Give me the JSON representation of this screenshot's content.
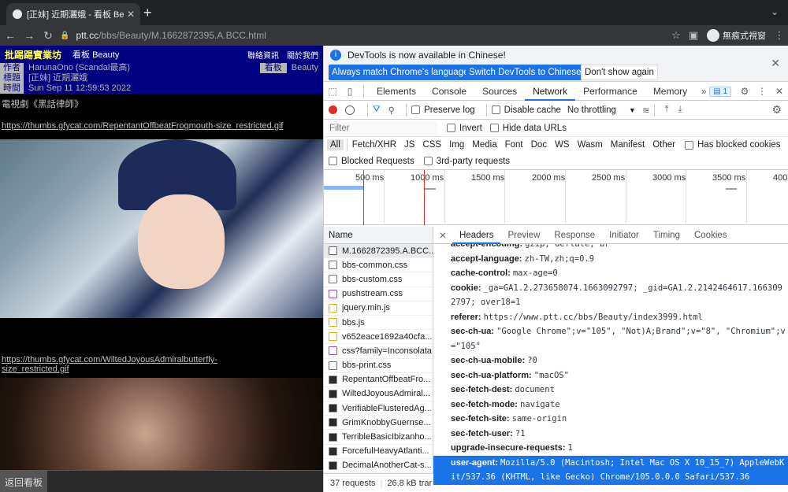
{
  "browser": {
    "tab_title": "[正妹] 近期灑娥 - 看板 Beauty - ",
    "url_host": "ptt.cc",
    "url_path": "/bbs/Beauty/M.1662872395.A.BCC.html",
    "profile_label": "無痕式視窗",
    "icons": {
      "back": "arrow-left-icon",
      "forward": "arrow-right-icon",
      "reload": "reload-icon",
      "lock": "lock-icon",
      "star": "star-icon",
      "new_tab": "plus-icon"
    }
  },
  "ptt": {
    "site_name": "批踢踢實業坊",
    "board_label": "看板 Beauty",
    "link_about": "聯絡資訊",
    "link_about2": "關於我們",
    "author_key": "作者",
    "author_val": "HarunaOno (Scandal最高)",
    "board_key": "看板",
    "board_val": "Beauty",
    "title_key": "標題",
    "title_val": "[正妹] 近期灑娥",
    "time_key": "時間",
    "time_val": "Sun Sep 11 12:59:53 2022",
    "body_title": "電視劇《黑話律師》",
    "link1": "https://thumbs.gfycat.com/RepentantOffbeatFrogmouth-size_restricted.gif",
    "link2a": "https://thumbs.gfycat.com/WiltedJoyousAdmiralbutterfly-",
    "link2b": "size_restricted.gif",
    "back_board": "返回看板"
  },
  "devtools": {
    "info_message": "DevTools is now available in Chinese!",
    "btn_match": "Always match Chrome's language",
    "btn_switch": "Switch DevTools to Chinese",
    "btn_dont": "Don't show again",
    "tabs": [
      "Elements",
      "Console",
      "Sources",
      "Network",
      "Performance",
      "Memory"
    ],
    "active_tab": "Network",
    "issues_count": "1",
    "preserve_log": "Preserve log",
    "disable_cache": "Disable cache",
    "throttling": "No throttling",
    "filter_placeholder": "Filter",
    "invert": "Invert",
    "hide_data_urls": "Hide data URLs",
    "types": [
      "All",
      "Fetch/XHR",
      "JS",
      "CSS",
      "Img",
      "Media",
      "Font",
      "Doc",
      "WS",
      "Wasm",
      "Manifest",
      "Other"
    ],
    "has_blocked_cookies": "Has blocked cookies",
    "blocked_requests": "Blocked Requests",
    "third_party": "3rd-party requests",
    "timeline_ticks": [
      "500 ms",
      "1000 ms",
      "1500 ms",
      "2000 ms",
      "2500 ms",
      "3000 ms",
      "3500 ms",
      "400"
    ],
    "name_header": "Name",
    "requests": [
      {
        "name": "M.1662872395.A.BCC...",
        "kind": "doc"
      },
      {
        "name": "bbs-common.css",
        "kind": "css"
      },
      {
        "name": "bbs-custom.css",
        "kind": "css"
      },
      {
        "name": "pushstream.css",
        "kind": "css"
      },
      {
        "name": "jquery.min.js",
        "kind": "js"
      },
      {
        "name": "bbs.js",
        "kind": "js"
      },
      {
        "name": "v652eace1692a40cfa...",
        "kind": "js"
      },
      {
        "name": "css?family=Inconsolata",
        "kind": "css"
      },
      {
        "name": "bbs-print.css",
        "kind": "css"
      },
      {
        "name": "RepentantOffbeatFro...",
        "kind": "img"
      },
      {
        "name": "WiltedJoyousAdmiral...",
        "kind": "img"
      },
      {
        "name": "VerifiableFlusteredAg...",
        "kind": "img"
      },
      {
        "name": "GrimKnobbyGuernse...",
        "kind": "img"
      },
      {
        "name": "TerribleBasicIbizanho...",
        "kind": "img"
      },
      {
        "name": "ForcefulHeavyAtlanti...",
        "kind": "img"
      },
      {
        "name": "DecimalAnotherCat-s...",
        "kind": "img"
      }
    ],
    "footer_requests": "37 requests",
    "footer_transfer": "26.8 kB trar",
    "detail_tabs": [
      "Headers",
      "Preview",
      "Response",
      "Initiator",
      "Timing",
      "Cookies"
    ],
    "active_detail_tab": "Headers",
    "headers": [
      {
        "k": "accept-encoding:",
        "v": "gzip, deflate, br"
      },
      {
        "k": "accept-language:",
        "v": "zh-TW,zh;q=0.9"
      },
      {
        "k": "cache-control:",
        "v": "max-age=0"
      },
      {
        "k": "cookie:",
        "v": "_ga=GA1.2.273658074.1663092797; _gid=GA1.2.2142464617.1663092797; over18=1"
      },
      {
        "k": "referer:",
        "v": "https://www.ptt.cc/bbs/Beauty/index3999.html"
      },
      {
        "k": "sec-ch-ua:",
        "v": "\"Google Chrome\";v=\"105\", \"Not)A;Brand\";v=\"8\", \"Chromium\";v=\"105\""
      },
      {
        "k": "sec-ch-ua-mobile:",
        "v": "?0"
      },
      {
        "k": "sec-ch-ua-platform:",
        "v": "\"macOS\""
      },
      {
        "k": "sec-fetch-dest:",
        "v": "document"
      },
      {
        "k": "sec-fetch-mode:",
        "v": "navigate"
      },
      {
        "k": "sec-fetch-site:",
        "v": "same-origin"
      },
      {
        "k": "sec-fetch-user:",
        "v": "?1"
      },
      {
        "k": "upgrade-insecure-requests:",
        "v": "1"
      },
      {
        "k": "user-agent:",
        "v": "Mozilla/5.0 (Macintosh; Intel Mac OS X 10_15_7) AppleWebKit/537.36 (KHTML, like Gecko) Chrome/105.0.0.0 Safari/537.36"
      }
    ]
  },
  "colors": {
    "accent": "#1a73e8",
    "record": "#d93025",
    "ptt_header": "#000080",
    "ptt_site": "#ffff55"
  }
}
